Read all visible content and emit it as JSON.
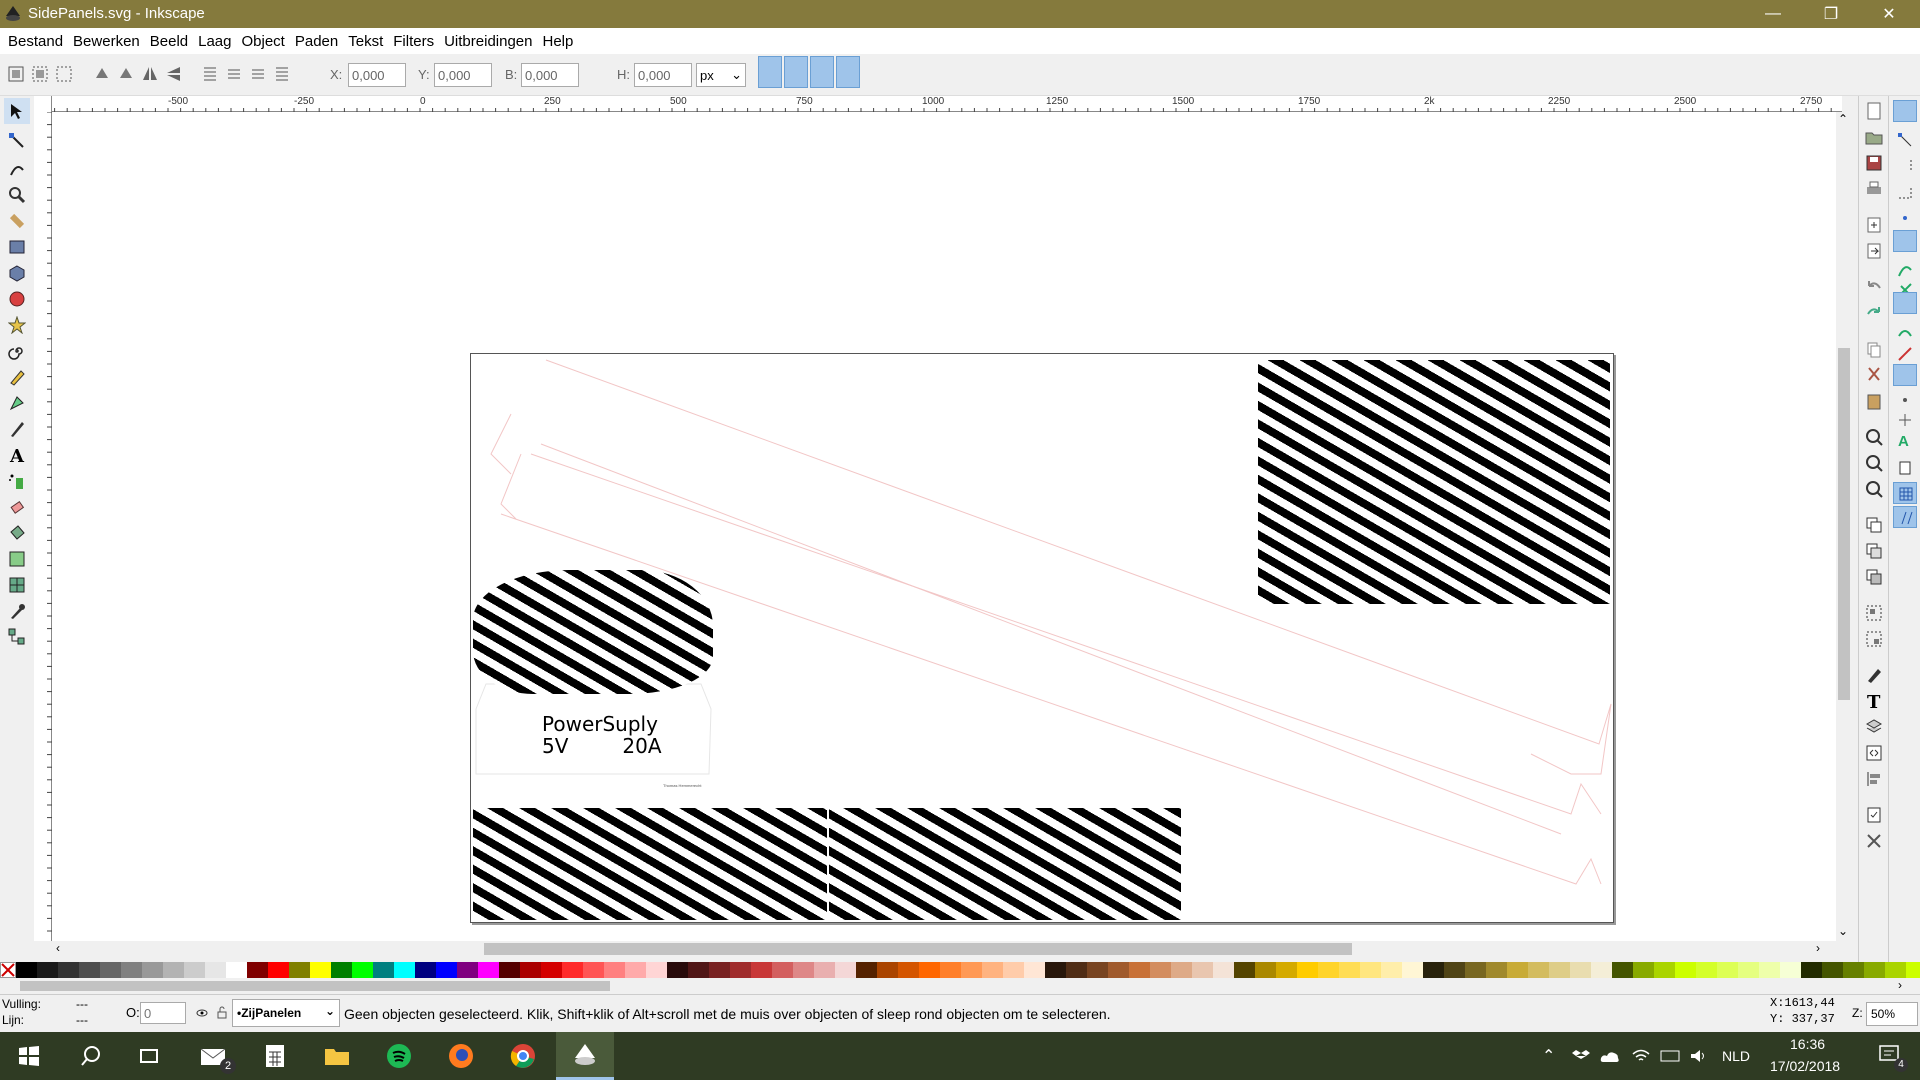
{
  "window": {
    "title": "SidePanels.svg - Inkscape",
    "minimize": "—",
    "maximize": "❐",
    "close": "✕"
  },
  "menu": [
    "Bestand",
    "Bewerken",
    "Beeld",
    "Laag",
    "Object",
    "Paden",
    "Tekst",
    "Filters",
    "Uitbreidingen",
    "Help"
  ],
  "toolbar": {
    "x_label": "X:",
    "x_value": "0,000",
    "y_label": "Y:",
    "y_value": "0,000",
    "w_label": "B:",
    "w_value": "0,000",
    "h_label": "H:",
    "h_value": "0,000",
    "unit": "px"
  },
  "ruler": {
    "ticks": [
      "-500",
      "-250",
      "0",
      "250",
      "500",
      "750",
      "1000",
      "1250",
      "1500",
      "1750",
      "2k",
      "2250",
      "2500",
      "2750"
    ]
  },
  "vruler": {
    "ticks": [
      "1",
      "0",
      "0",
      "5",
      "0",
      "0",
      "0",
      "0",
      "5",
      "0",
      "0"
    ]
  },
  "canvas": {
    "label_title": "PowerSuply",
    "label_v": "5V",
    "label_a": "20A",
    "small_note": "Thomas Hemmerecht"
  },
  "status": {
    "fill_label": "Vulling:",
    "fill_value": "---",
    "stroke_label": "Lijn:",
    "stroke_value": "---",
    "opacity_label": "O:",
    "opacity_value": "0",
    "layer": "•ZijPanelen",
    "message": "Geen objecten geselecteerd. Klik, Shift+klik of Alt+scroll met de muis over objecten of sleep rond objecten om te selecteren.",
    "x_coord": "X:1613,44",
    "y_coord": "Y: 337,37",
    "zoom_label": "Z:",
    "zoom": "50%"
  },
  "taskbar": {
    "mail_badge": "2",
    "lang": "NLD",
    "time": "16:36",
    "date": "17/02/2018",
    "notif": "4"
  },
  "colors": {
    "titlebar": "#857a3d",
    "taskbar": "#2f3b23",
    "snap_active": "#9fc4ea",
    "palette": [
      "#000000",
      "#1a1a1a",
      "#333333",
      "#4d4d4d",
      "#666666",
      "#808080",
      "#999999",
      "#b3b3b3",
      "#cccccc",
      "#e6e6e6",
      "#ffffff",
      "#800000",
      "#ff0000",
      "#808000",
      "#ffff00",
      "#008000",
      "#00ff00",
      "#008080",
      "#00ffff",
      "#000080",
      "#0000ff",
      "#800080",
      "#ff00ff",
      "#550000",
      "#aa0000",
      "#d40000",
      "#ff2a2a",
      "#ff5555",
      "#ff8080",
      "#ffaaaa",
      "#ffd5d5",
      "#280b0b",
      "#501616",
      "#782121",
      "#a02c2c",
      "#c83737",
      "#d35f5f",
      "#de8787",
      "#e9afaf",
      "#f4d7d7",
      "#552200",
      "#aa4400",
      "#d45500",
      "#ff6600",
      "#ff7f2a",
      "#ff9955",
      "#ffb380",
      "#ffccaa",
      "#ffe6d5",
      "#28170b",
      "#502d16",
      "#784421",
      "#a05a2c",
      "#c87137",
      "#d38d5f",
      "#deaa87",
      "#e9c6af",
      "#f4e3d7",
      "#554400",
      "#aa8800",
      "#d4aa00",
      "#ffcc00",
      "#ffd42a",
      "#ffdd55",
      "#ffe680",
      "#ffeeaa",
      "#fff6d5",
      "#28220b",
      "#504416",
      "#786721",
      "#a0892c",
      "#c8ab37",
      "#d3bc5f",
      "#decd87",
      "#e9ddaf",
      "#f4eed7",
      "#445500",
      "#88aa00",
      "#aad400",
      "#ccff00",
      "#d4ff2a",
      "#ddff55",
      "#e5ff80",
      "#eeffaa",
      "#f6ffd5",
      "#222b00",
      "#445500",
      "#668000",
      "#88aa00",
      "#aad400",
      "#ccff00"
    ]
  }
}
